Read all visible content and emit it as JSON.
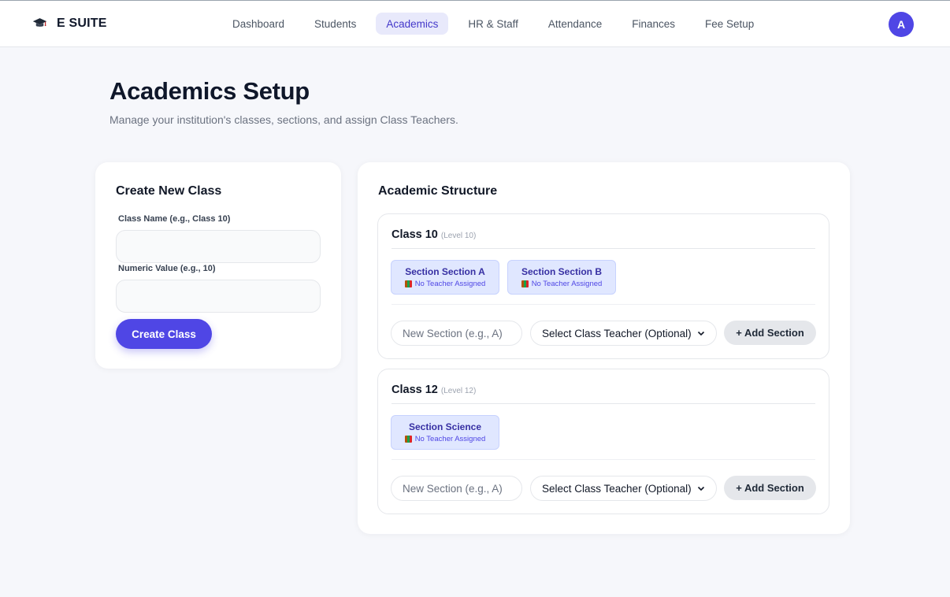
{
  "brand": {
    "name": "E SUITE",
    "icon": "graduation-cap-icon"
  },
  "nav": [
    {
      "label": "Dashboard",
      "active": false
    },
    {
      "label": "Students",
      "active": false
    },
    {
      "label": "Academics",
      "active": true
    },
    {
      "label": "HR & Staff",
      "active": false
    },
    {
      "label": "Attendance",
      "active": false
    },
    {
      "label": "Finances",
      "active": false
    },
    {
      "label": "Fee Setup",
      "active": false
    }
  ],
  "user": {
    "avatar_initial": "A"
  },
  "page": {
    "title": "Academics Setup",
    "subtitle": "Manage your institution's classes, sections, and assign Class Teachers."
  },
  "create_class": {
    "heading": "Create New Class",
    "name_label": "Class Name (e.g., Class 10)",
    "name_value": "",
    "numeric_label": "Numeric Value (e.g., 10)",
    "numeric_value": "",
    "button_label": "Create Class"
  },
  "structure": {
    "heading": "Academic Structure",
    "classes": [
      {
        "name": "Class 10",
        "level": "(Level 10)",
        "sections": [
          {
            "name": "Section Section A",
            "teacher": "No Teacher Assigned"
          },
          {
            "name": "Section Section B",
            "teacher": "No Teacher Assigned"
          }
        ],
        "section_placeholder": "New Section (e.g., A)",
        "teacher_select": "Select Class Teacher (Optional)",
        "add_label": "+ Add Section"
      },
      {
        "name": "Class 12",
        "level": "(Level 12)",
        "sections": [
          {
            "name": "Section Science",
            "teacher": "No Teacher Assigned"
          }
        ],
        "section_placeholder": "New Section (e.g., A)",
        "teacher_select": "Select Class Teacher (Optional)",
        "add_label": "+ Add Section"
      }
    ]
  },
  "colors": {
    "accent": "#4f46e5",
    "chip_bg": "#e0e7ff",
    "chip_border": "#c7d2fe",
    "background": "#f6f7fb"
  }
}
